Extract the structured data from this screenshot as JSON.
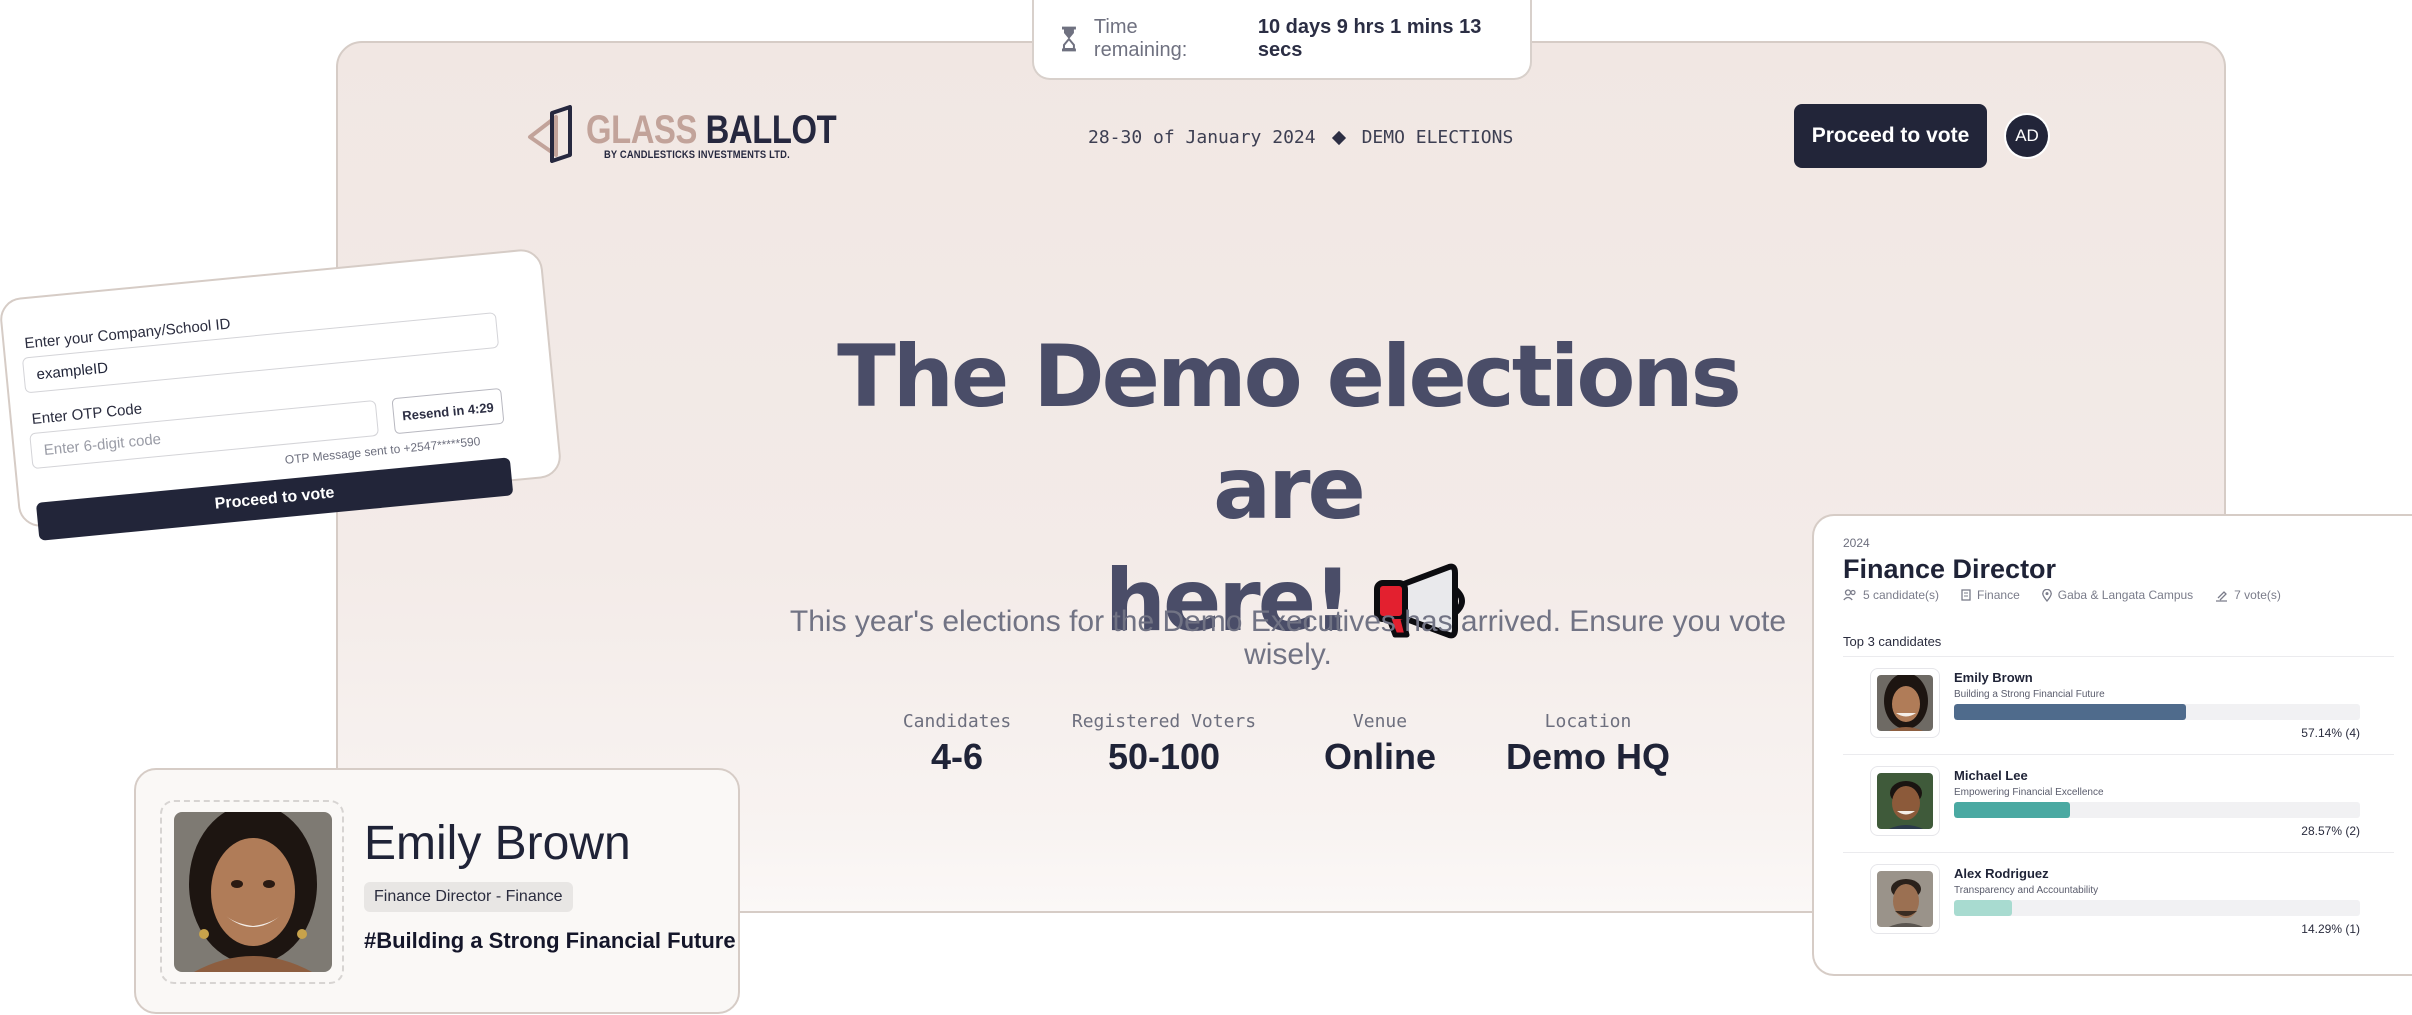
{
  "timer": {
    "label": "Time remaining:",
    "value": "10 days 9 hrs 1 mins 13 secs",
    "icon": "hourglass-icon"
  },
  "header": {
    "logo_word_1": "GLASS",
    "logo_word_2": "BALLOT",
    "logo_sub": "BY CANDLESTICKS INVESTMENTS LTD.",
    "dates": "28-30 of January 2024",
    "event": "DEMO ELECTIONS",
    "proceed_label": "Proceed to vote",
    "avatar_initials": "AD"
  },
  "hero": {
    "headline_line1": "The Demo elections are",
    "headline_line2": "here!",
    "headline_icon": "megaphone-icon",
    "subline": "This year's elections for the Demo Executives has arrived. Ensure you vote wisely."
  },
  "stats": [
    {
      "label": "Candidates",
      "value": "4-6"
    },
    {
      "label": "Registered Voters",
      "value": "50-100"
    },
    {
      "label": "Venue",
      "value": "Online"
    },
    {
      "label": "Location",
      "value": "Demo HQ"
    }
  ],
  "login": {
    "id_label": "Enter your Company/School ID",
    "id_value": "exampleID",
    "otp_label": "Enter OTP Code",
    "otp_placeholder": "Enter 6-digit code",
    "resend_label": "Resend in 4:29",
    "otp_note": "OTP Message sent to +2547*****590",
    "submit_label": "Proceed to vote"
  },
  "candidate_card": {
    "name": "Emily Brown",
    "role": "Finance Director - Finance",
    "slogan": "#Building a Strong Financial Future"
  },
  "results": {
    "year": "2024",
    "position": "Finance Director",
    "candidates_meta": "5 candidate(s)",
    "department": "Finance",
    "campus": "Gaba & Langata Campus",
    "votes_meta": "7 vote(s)",
    "top_label": "Top 3 candidates",
    "rows": [
      {
        "name": "Emily Brown",
        "slogan": "Building a Strong Financial Future",
        "share": 0.5714,
        "pct_text": "57.14% (4)",
        "color": "#4f6b8c"
      },
      {
        "name": "Michael Lee",
        "slogan": "Empowering Financial Excellence",
        "share": 0.2857,
        "pct_text": "28.57% (2)",
        "color": "#4aa9a2"
      },
      {
        "name": "Alex Rodriguez",
        "slogan": "Transparency and Accountability",
        "share": 0.1429,
        "pct_text": "14.29% (1)",
        "color": "#a8dbd0"
      }
    ]
  }
}
